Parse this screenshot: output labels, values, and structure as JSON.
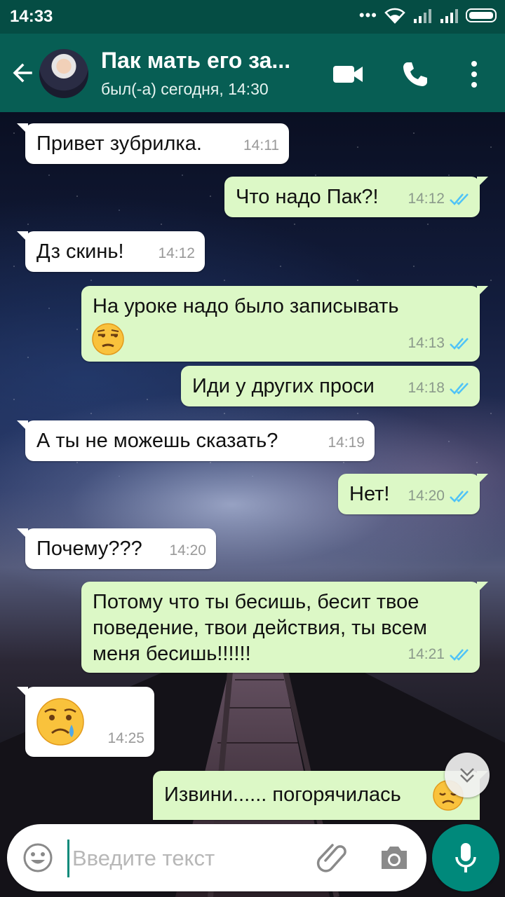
{
  "status_bar": {
    "time": "14:33",
    "dots": "•••"
  },
  "header": {
    "title": "Пак мать его за...",
    "subtitle": "был(-а) сегодня, 14:30"
  },
  "messages": [
    {
      "direction": "in",
      "text": "Привет зубрилка.",
      "time": "14:11"
    },
    {
      "direction": "out",
      "text": "Что надо Пак?!",
      "time": "14:12",
      "read": true
    },
    {
      "direction": "in",
      "text": "Дз скинь!",
      "time": "14:12"
    },
    {
      "direction": "out",
      "text": "На уроке надо было записывать",
      "emoji": "unamused-face-icon",
      "time": "14:13",
      "read": true
    },
    {
      "direction": "out",
      "text": "Иди у других проси",
      "time": "14:18",
      "read": true
    },
    {
      "direction": "in",
      "text": "А ты не можешь сказать?",
      "time": "14:19"
    },
    {
      "direction": "out",
      "text": "Нет!",
      "time": "14:20",
      "read": true
    },
    {
      "direction": "in",
      "text": "Почему???",
      "time": "14:20"
    },
    {
      "direction": "out",
      "text": "Потому что ты бесишь, бесит твое поведение, твои действия, ты всем меня бесишь!!!!!!",
      "time": "14:21",
      "read": true
    },
    {
      "direction": "in",
      "emoji": "crying-face-icon",
      "time": "14:25"
    },
    {
      "direction": "out",
      "text": "Извини...... погорячилась",
      "emoji": "disappointed-face-icon",
      "partial": true
    }
  ],
  "composer": {
    "placeholder": "Введите текст"
  },
  "colors": {
    "status_bar": "#054d44",
    "app_bar": "#075e54",
    "outgoing_bubble": "#dcf8c6",
    "incoming_bubble": "#ffffff",
    "read_ticks": "#4fc3f7",
    "mic_button": "#00897b"
  }
}
